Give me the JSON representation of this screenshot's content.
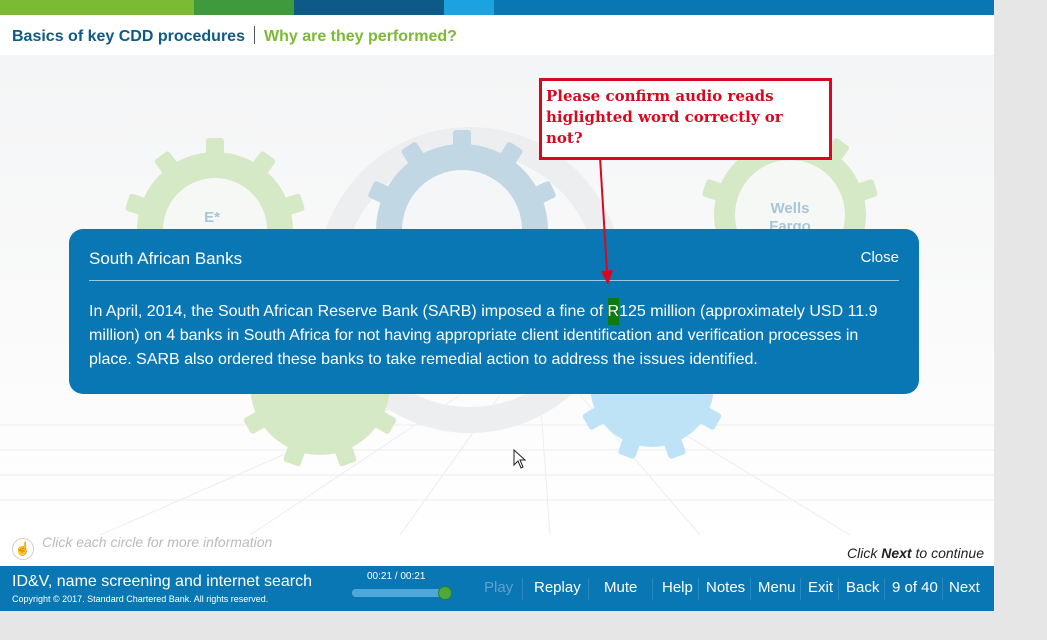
{
  "header": {
    "title": "Basics of key CDD procedures",
    "subtitle": "Why are they performed?"
  },
  "colors": {
    "brand_blue": "#0977b4",
    "brand_green": "#7cba34",
    "highlight_green": "#0e7a0e",
    "annotation_red": "#d9081e"
  },
  "background": {
    "gears": [
      {
        "label": "E*"
      },
      {
        "label": ""
      },
      {
        "label": "Wells Fargo"
      }
    ]
  },
  "dialog": {
    "title": "South African Banks",
    "close_label": "Close",
    "text_before": "In April, 2014, the South African Reserve Bank (SARB) imposed a fine of ",
    "highlight": "R",
    "text_after": "125 million (approximately USD 11.9 million) on 4 banks in South Africa for not having appropriate client identification and verification processes in place. SARB also ordered these banks to take remedial action to address the issues identified."
  },
  "annotation": {
    "text": "Please confirm audio reads higlighted word correctly or not?"
  },
  "hint": {
    "icon": "hand-pointer-icon",
    "text": "Click each circle for more information"
  },
  "continue": {
    "prefix": "Click ",
    "next": "Next",
    "suffix": " to continue"
  },
  "footer": {
    "course_title": "ID&V, name screening and internet search",
    "copyright": "Copyright © 2017. Standard Chartered Bank. All rights reserved.",
    "time": "00:21 / 00:21",
    "progress": 1.0,
    "play": "Play",
    "replay": "Replay",
    "mute": "Mute",
    "help": "Help",
    "notes": "Notes",
    "menu": "Menu",
    "exit": "Exit",
    "back": "Back",
    "page": "9 of 40",
    "next": "Next"
  }
}
